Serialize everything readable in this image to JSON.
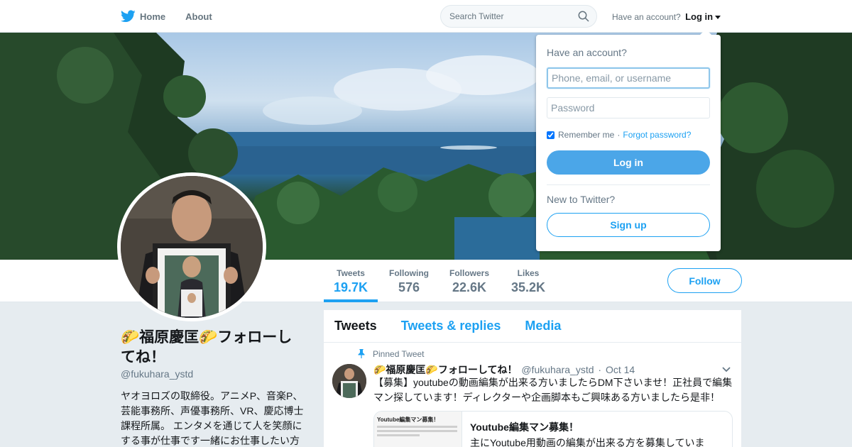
{
  "nav": {
    "home_label": "Home",
    "about_label": "About",
    "search_placeholder": "Search Twitter",
    "account_prompt": "Have an account?",
    "login_label": "Log in"
  },
  "stats": [
    {
      "label": "Tweets",
      "value": "19.7K"
    },
    {
      "label": "Following",
      "value": "576"
    },
    {
      "label": "Followers",
      "value": "22.6K"
    },
    {
      "label": "Likes",
      "value": "35.2K"
    }
  ],
  "follow_label": "Follow",
  "profile": {
    "name": "🌮福原慶匡🌮フォローしてね！",
    "handle": "@fukuhara_ystd",
    "bio": "ヤオヨロズの取締役。アニメP、音楽P、芸能事務所、声優事務所、VR、慶応博士課程所属。 エンタメを通じて人を笑顔にする事が仕事です一緒にお仕事したい方"
  },
  "timeline": {
    "tabs": [
      "Tweets",
      "Tweets & replies",
      "Media"
    ],
    "pinned_label": "Pinned Tweet",
    "tweet": {
      "name": "🌮福原慶匡🌮フォローしてね！",
      "handle": "@fukuhara_ystd",
      "sep": "·",
      "date": "Oct 14",
      "text": "【募集】youtubeの動画編集が出来る方いましたらDM下さいませ！正社員で編集マン探しています！ディレクターや企画脚本もご興味ある方いましたら是非！",
      "card": {
        "thumb_text": "Youtube編集マン募集！",
        "title": "Youtube編集マン募集！",
        "description": "主にYoutube用動画の編集が出来る方を募集していま"
      }
    }
  },
  "login_dropdown": {
    "title": "Have an account?",
    "username_placeholder": "Phone, email, or username",
    "password_placeholder": "Password",
    "remember_label": "Remember me",
    "separator": "·",
    "forgot_label": "Forgot password?",
    "login_button": "Log in",
    "new_prompt": "New to Twitter?",
    "signup_button": "Sign up"
  },
  "colors": {
    "accent": "#1da1f2",
    "background": "#e6ecf0",
    "muted": "#657786"
  },
  "icons": [
    "twitter-bird-icon",
    "search-icon",
    "caret-down-icon",
    "pin-icon",
    "chevron-down-icon"
  ]
}
